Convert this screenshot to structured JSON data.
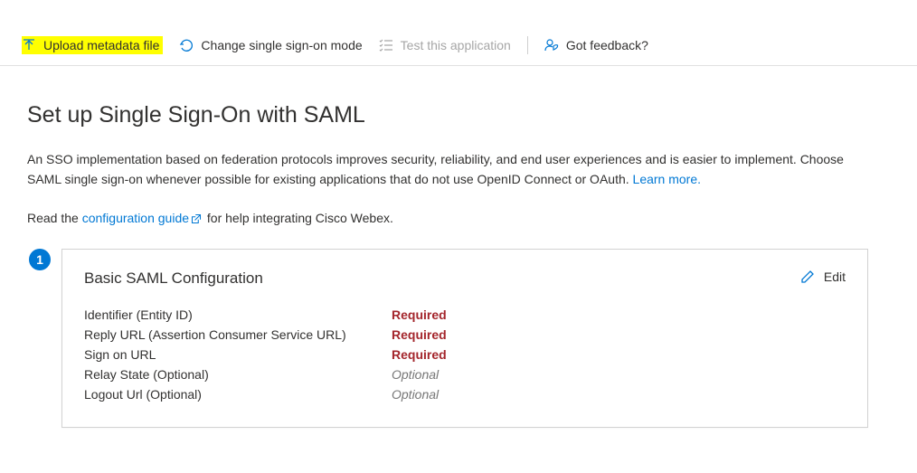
{
  "toolbar": {
    "upload": "Upload metadata file",
    "change": "Change single sign-on mode",
    "test": "Test this application",
    "feedback": "Got feedback?"
  },
  "heading": "Set up Single Sign-On with SAML",
  "description_part1": "An SSO implementation based on federation protocols improves security, reliability, and end user experiences and is easier to implement. Choose SAML single sign-on whenever possible for existing applications that do not use OpenID Connect or OAuth. ",
  "learn_more": "Learn more.",
  "guide_prefix": "Read the ",
  "guide_link": "configuration guide",
  "guide_suffix": " for help integrating Cisco Webex.",
  "step1_number": "1",
  "card": {
    "title": "Basic SAML Configuration",
    "edit": "Edit",
    "rows": [
      {
        "label": "Identifier (Entity ID)",
        "value": "Required",
        "required": true
      },
      {
        "label": "Reply URL (Assertion Consumer Service URL)",
        "value": "Required",
        "required": true
      },
      {
        "label": "Sign on URL",
        "value": "Required",
        "required": true
      },
      {
        "label": "Relay State (Optional)",
        "value": "Optional",
        "required": false
      },
      {
        "label": "Logout Url (Optional)",
        "value": "Optional",
        "required": false
      }
    ]
  }
}
